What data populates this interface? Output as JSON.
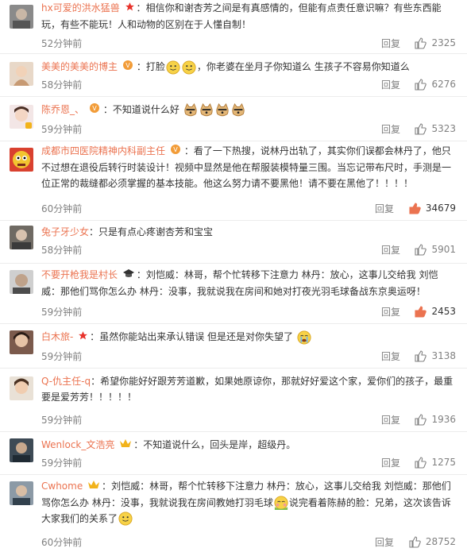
{
  "comments": [
    {
      "nickname": "hx可爱的洪水猛兽",
      "text": "相信你和谢杏芳之间是有真感情的，但能有点责任意识嘛？有些东西能玩，有些不能玩！人和动物的区别在于人懂自制！",
      "time": "52分钟前",
      "reply": "回复",
      "likes": "2325"
    },
    {
      "nickname": "美美的美美的博主",
      "text_a": "打脸",
      "text_b": "，你老婆在坐月子你知道么 生孩子不容易你知道么",
      "time": "58分钟前",
      "reply": "回复",
      "likes": "6276"
    },
    {
      "nickname": "陈乔恩_、",
      "text": "不知道说什么好",
      "time": "59分钟前",
      "reply": "回复",
      "likes": "5323"
    },
    {
      "nickname": "成都市四医院精神内科副主任",
      "text": "看了一下热搜，说林丹出轨了，其实你们误都会林丹了，他只不过想在退役后转行时装设计！视频中显然是他在帮服装模特量三围。当忘记带布尺时，手测是一位正常的裁缝都必须掌握的基本技能。他这么努力请不要黑他！请不要在黑他了！！！！",
      "time": "60分钟前",
      "reply": "回复",
      "likes": "34679"
    },
    {
      "nickname": "兔子牙少女",
      "text": "只是有点心疼谢杏芳和宝宝",
      "time": "58分钟前",
      "reply": "回复",
      "likes": "5901"
    },
    {
      "nickname": "不要开枪我是村长",
      "text": "刘恺威：林哥，帮个忙转移下注意力 林丹：放心，这事儿交给我 刘恺威：那他们骂你怎么办 林丹：没事，我就说我在房间和她对打夜光羽毛球备战东京奥运呀！",
      "time": "59分钟前",
      "reply": "回复",
      "likes": "2453"
    },
    {
      "nickname": "白木旅-",
      "text": "虽然你能站出来承认错误 但是还是对你失望了",
      "time": "59分钟前",
      "reply": "回复",
      "likes": "3138"
    },
    {
      "nickname": "Q-仇主任-q",
      "text": "希望你能好好跟芳芳道歉，如果她原谅你，那就好好爱这个家，爱你们的孩子，最重要是爱芳芳！！！！！",
      "time": "59分钟前",
      "reply": "回复",
      "likes": "1936"
    },
    {
      "nickname": "Wenlock_文浩亮",
      "text": "不知道说什么，回头是岸，超级丹。",
      "time": "59分钟前",
      "reply": "回复",
      "likes": "1275"
    },
    {
      "nickname": "Cwhome",
      "text_a": "刘恺威：林哥，帮个忙转移下注意力  林丹：放心，这事儿交给我  刘恺威：那他们骂你怎么办  林丹：没事，我就说我在房间教她打羽毛球",
      "text_b": "说完看着陈赫的脸：兄弟，这次该告诉大家我们的关系了",
      "time": "60分钟前",
      "reply": "回复",
      "likes": "28752"
    }
  ],
  "colors": {
    "nickname": "#eb7350",
    "like_hot": "#eb7350",
    "meta": "#808080"
  }
}
